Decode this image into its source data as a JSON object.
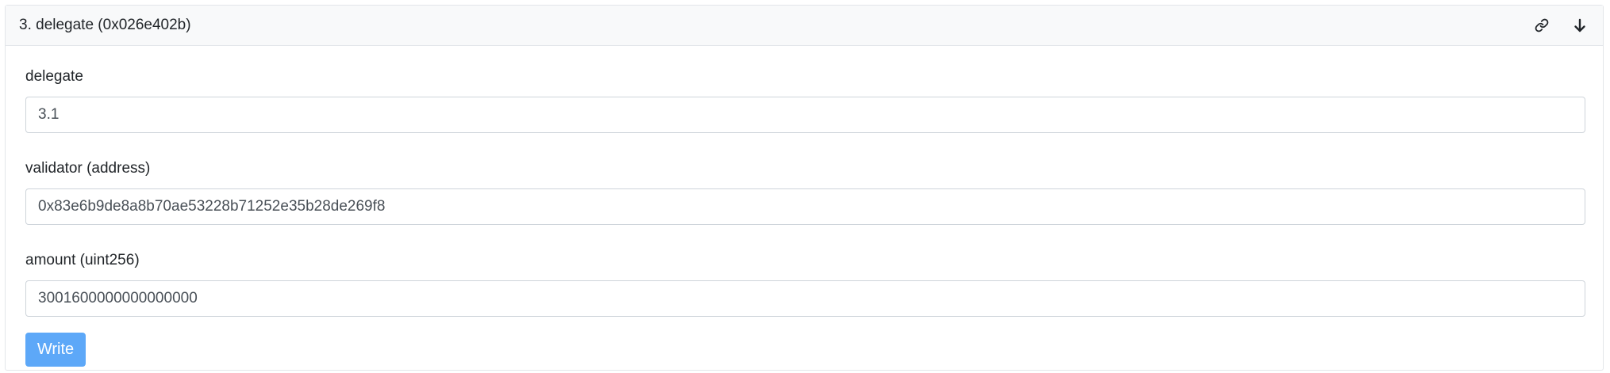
{
  "card": {
    "title": "3. delegate (0x026e402b)",
    "header_icons": [
      "link-icon",
      "arrow-down-icon"
    ]
  },
  "form": {
    "fields": [
      {
        "label": "delegate",
        "value": "3.1"
      },
      {
        "label": "validator (address)",
        "value": "0x83e6b9de8a8b70ae53228b71252e35b28de269f8"
      },
      {
        "label": "amount (uint256)",
        "value": "3001600000000000000"
      }
    ],
    "write_label": "Write"
  },
  "colors": {
    "header_bg": "#f8f9fa",
    "border": "#e3e6ea",
    "write_button": "#5da8f8"
  }
}
